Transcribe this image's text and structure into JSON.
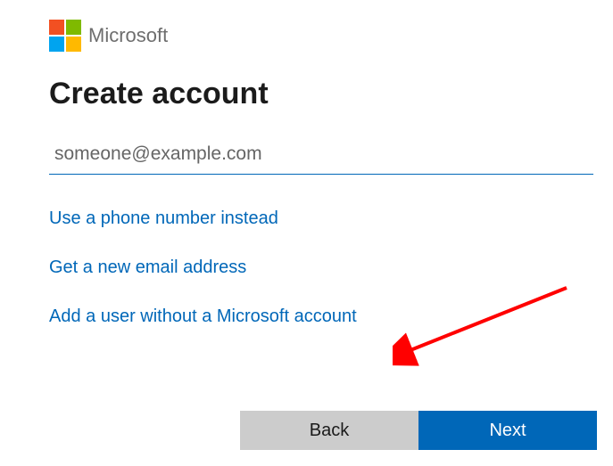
{
  "brand": "Microsoft",
  "title": "Create account",
  "email_placeholder": "someone@example.com",
  "links": {
    "phone": "Use a phone number instead",
    "new_email": "Get a new email address",
    "no_ms_account": "Add a user without a Microsoft account"
  },
  "buttons": {
    "back": "Back",
    "next": "Next"
  },
  "colors": {
    "accent": "#0067b8"
  }
}
